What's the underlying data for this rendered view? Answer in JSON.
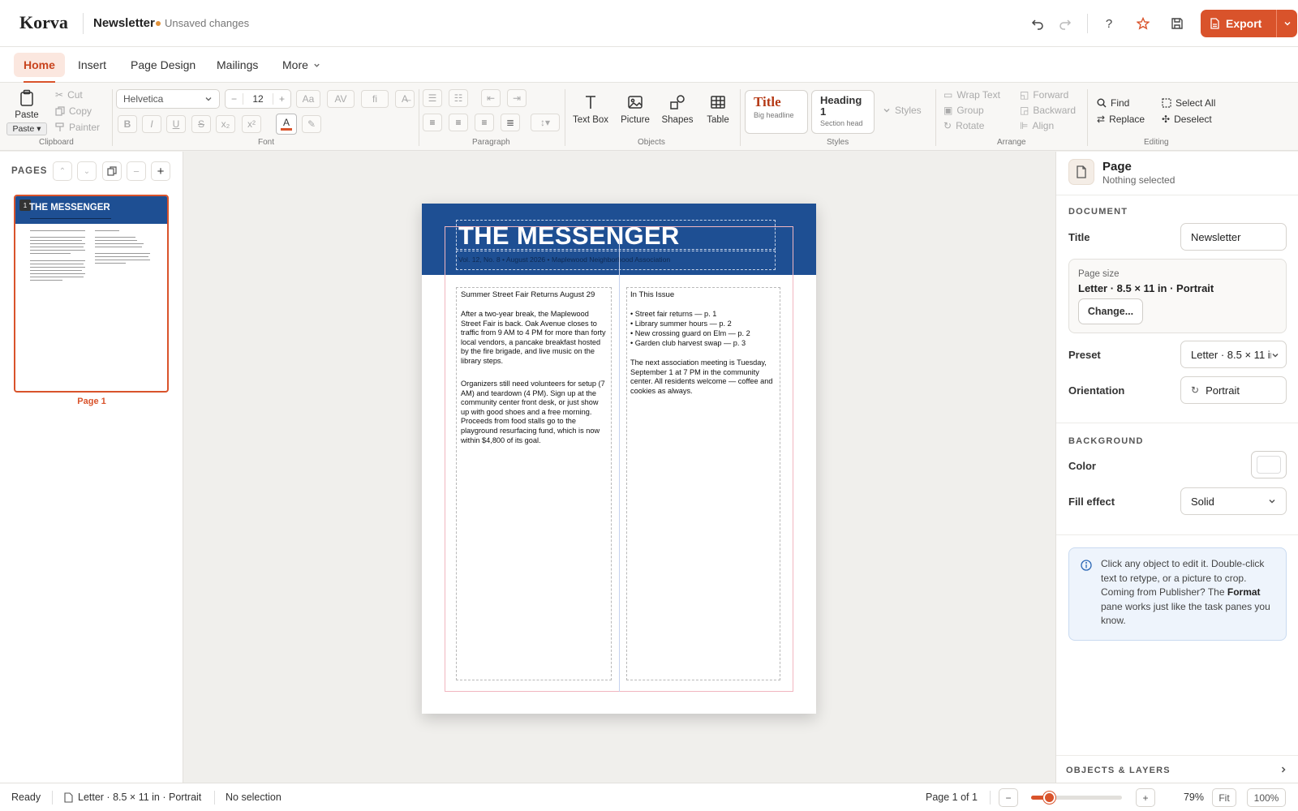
{
  "app": {
    "logo": "Korva",
    "doc_title": "Newsletter",
    "save_status": "Unsaved changes",
    "export_label": "Export",
    "accent": "#d9532b"
  },
  "tabs": [
    "Home",
    "Insert",
    "Page Design",
    "Mailings",
    "More"
  ],
  "ribbon": {
    "clipboard": {
      "paste": "Paste",
      "paste_menu": "Paste ▾",
      "cut": "Cut",
      "copy": "Copy",
      "painter": "Painter",
      "label": "Clipboard"
    },
    "font": {
      "family": "Helvetica",
      "size": "12",
      "label": "Font",
      "case": "Aa",
      "spacing": "AV",
      "ligature": "fi",
      "bold": "B",
      "italic": "I",
      "underline": "U",
      "strike": "S",
      "sub": "x₂",
      "sup": "x²",
      "color_letter": "A"
    },
    "paragraph": {
      "label": "Paragraph"
    },
    "objects": {
      "items": [
        "Text Box",
        "Picture",
        "Shapes",
        "Table"
      ],
      "label": "Objects"
    },
    "styles": {
      "title": "Title",
      "title_desc": "Big headline",
      "heading": "Heading 1",
      "heading_desc": "Section head",
      "more": "Styles",
      "label": "Styles"
    },
    "arrange": {
      "wrap": "Wrap Text",
      "group": "Group",
      "rotate": "Rotate",
      "forward": "Forward",
      "backward": "Backward",
      "align": "Align",
      "label": "Arrange"
    },
    "editing": {
      "find": "Find",
      "replace": "Replace",
      "select_all": "Select All",
      "deselect": "Deselect",
      "label": "Editing"
    }
  },
  "pages_panel": {
    "title": "PAGES",
    "thumb_number": "1",
    "thumb_title": "THE MESSENGER",
    "page_label": "Page 1"
  },
  "newsletter": {
    "title": "THE MESSENGER",
    "subtitle": "Vol. 12, No. 8 • August 2026 • Maplewood Neighborhood Association",
    "left_heading": "Summer Street Fair Returns August 29",
    "left_p1": "After a two-year break, the Maplewood Street Fair is back. Oak Avenue closes to traffic from 9 AM to 4 PM for more than forty local vendors, a pancake breakfast hosted by the fire brigade, and live music on the library steps.",
    "left_p2": "Organizers still need volunteers for setup (7 AM) and teardown (4 PM). Sign up at the community center front desk, or just show up with good shoes and a free morning. Proceeds from food stalls go to the playground resurfacing fund, which is now within $4,800 of its goal.",
    "right_heading": "In This Issue",
    "right_items": [
      "• Street fair returns — p. 1",
      "• Library summer hours — p. 2",
      "• New crossing guard on Elm — p. 2",
      "• Garden club harvest swap — p. 3"
    ],
    "right_p": "The next association meeting is Tuesday, September 1 at 7 PM in the community center. All residents welcome — coffee and cookies as always.",
    "banner_color": "#1e4f93"
  },
  "format_pane": {
    "title": "Page",
    "subtitle": "Nothing selected",
    "doc_section": "DOCUMENT",
    "title_label": "Title",
    "title_value": "Newsletter",
    "page_size_label": "Page size",
    "page_size_value": "Letter · 8.5 × 11 in · Portrait",
    "change_btn": "Change...",
    "preset_label": "Preset",
    "preset_value": "Letter · 8.5 × 11 in",
    "orientation_label": "Orientation",
    "orientation_value": "Portrait",
    "bg_section": "BACKGROUND",
    "color_label": "Color",
    "bg_color": "#ffffff",
    "fill_label": "Fill effect",
    "fill_value": "Solid",
    "tip_a": "Click any object to edit it. Double-click text to retype, or a picture to crop. Coming from Publisher? The ",
    "tip_bold": "Format",
    "tip_b": " pane works just like the task panes you know.",
    "layers": "OBJECTS & LAYERS"
  },
  "status": {
    "state": "Ready",
    "page_size": "Letter · 8.5 × 11 in · Portrait",
    "selection": "No selection",
    "page_count": "Page 1 of 1",
    "zoom": "79%",
    "zoom_value": 0.79,
    "fit": "Fit",
    "hundred": "100%"
  }
}
